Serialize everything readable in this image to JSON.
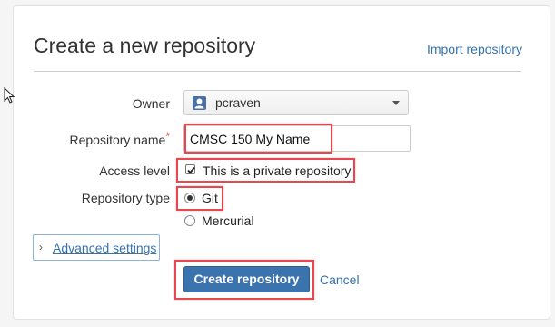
{
  "page": {
    "title": "Create a new repository",
    "import_link": "Import repository"
  },
  "form": {
    "owner": {
      "label": "Owner",
      "value": "pcraven"
    },
    "repository_name": {
      "label": "Repository name",
      "required_marker": "*",
      "value": "CMSC 150 My Name"
    },
    "access_level": {
      "label": "Access level",
      "checkbox_label": "This is a private repository",
      "checked": true
    },
    "repository_type": {
      "label": "Repository type",
      "options": [
        {
          "label": "Git",
          "selected": true
        },
        {
          "label": "Mercurial",
          "selected": false
        }
      ]
    },
    "advanced_settings": {
      "chevron": "›",
      "label": "Advanced settings"
    },
    "actions": {
      "create_label": "Create repository",
      "cancel_label": "Cancel"
    }
  },
  "colors": {
    "highlight": "#e8474f",
    "primary_button": "#3b73af",
    "link": "#3572b0"
  },
  "icons": {
    "owner_avatar": "user-avatar-icon",
    "dropdown": "caret-down-icon",
    "cursor": "mouse-pointer-icon"
  }
}
